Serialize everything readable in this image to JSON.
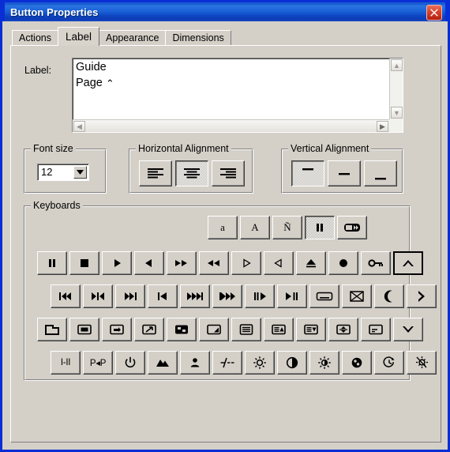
{
  "window": {
    "title": "Button Properties",
    "close_label": "Close"
  },
  "tabs": [
    {
      "label": "Actions",
      "selected": false
    },
    {
      "label": "Label",
      "selected": true
    },
    {
      "label": "Appearance",
      "selected": false
    },
    {
      "label": "Dimensions",
      "selected": false
    }
  ],
  "label_section": {
    "caption": "Label:",
    "value_line1": "Guide",
    "value_line2": "Page",
    "value_glyph": "⌃",
    "scroll_up": "▲",
    "scroll_down": "▼",
    "scroll_left": "◀",
    "scroll_right": "▶"
  },
  "font_size": {
    "group_title": "Font size",
    "value": "12",
    "dropdown_icon": "▼"
  },
  "horizontal_alignment": {
    "group_title": "Horizontal Alignment",
    "buttons": [
      {
        "name": "align-left",
        "selected": false
      },
      {
        "name": "align-center",
        "selected": true
      },
      {
        "name": "align-right",
        "selected": false
      }
    ]
  },
  "vertical_alignment": {
    "group_title": "Vertical Alignment",
    "buttons": [
      {
        "name": "align-top",
        "selected": true
      },
      {
        "name": "align-middle",
        "selected": false
      },
      {
        "name": "align-bottom",
        "selected": false
      }
    ]
  },
  "keyboards": {
    "group_title": "Keyboards",
    "rows": [
      {
        "id": "row1",
        "buttons": [
          {
            "icon": "lowercase-a-icon",
            "text": "a",
            "state": "normal"
          },
          {
            "icon": "uppercase-a-icon",
            "text": "A",
            "state": "normal"
          },
          {
            "icon": "n-tilde-icon",
            "text": "Ñ",
            "state": "normal"
          },
          {
            "icon": "pause-icon",
            "text": "",
            "state": "pressed"
          },
          {
            "icon": "remote-device-icon",
            "text": "",
            "state": "normal"
          }
        ]
      },
      {
        "id": "row2",
        "buttons": [
          {
            "icon": "pause-icon",
            "text": "",
            "state": "normal"
          },
          {
            "icon": "stop-icon",
            "text": "",
            "state": "normal"
          },
          {
            "icon": "play-icon",
            "text": "",
            "state": "normal"
          },
          {
            "icon": "play-reverse-icon",
            "text": "",
            "state": "normal"
          },
          {
            "icon": "fast-forward-icon",
            "text": "",
            "state": "normal"
          },
          {
            "icon": "rewind-icon",
            "text": "",
            "state": "normal"
          },
          {
            "icon": "play-outline-icon",
            "text": "",
            "state": "normal"
          },
          {
            "icon": "play-reverse-outline-icon",
            "text": "",
            "state": "normal"
          },
          {
            "icon": "eject-icon",
            "text": "",
            "state": "normal"
          },
          {
            "icon": "record-icon",
            "text": "",
            "state": "normal"
          },
          {
            "icon": "key-icon",
            "text": "",
            "state": "normal"
          },
          {
            "icon": "chevron-up-icon",
            "text": "",
            "state": "focused"
          }
        ]
      },
      {
        "id": "row3",
        "buttons": [
          {
            "icon": "skip-previous-bar-icon",
            "text": "",
            "state": "normal"
          },
          {
            "icon": "step-both-icon",
            "text": "",
            "state": "normal"
          },
          {
            "icon": "skip-next-bar-icon",
            "text": "",
            "state": "normal"
          },
          {
            "icon": "previous-track-icon",
            "text": "",
            "state": "normal"
          },
          {
            "icon": "next-track-double-icon",
            "text": "",
            "state": "normal"
          },
          {
            "icon": "previous-track-double-icon",
            "text": "",
            "state": "normal"
          },
          {
            "icon": "pause-play-icon",
            "text": "",
            "state": "normal"
          },
          {
            "icon": "play-pause-reverse-icon",
            "text": "",
            "state": "normal"
          },
          {
            "icon": "subtitle-icon",
            "text": "",
            "state": "normal"
          },
          {
            "icon": "crossed-box-icon",
            "text": "",
            "state": "normal"
          },
          {
            "icon": "moon-icon",
            "text": "",
            "state": "normal"
          },
          {
            "icon": "chevron-right-icon",
            "text": "",
            "state": "normal"
          }
        ]
      },
      {
        "id": "row4",
        "buttons": [
          {
            "icon": "screen-corner-icon",
            "text": "",
            "state": "normal"
          },
          {
            "icon": "screen-filled-icon",
            "text": "",
            "state": "normal"
          },
          {
            "icon": "screen-swap-icon",
            "text": "",
            "state": "normal"
          },
          {
            "icon": "screen-expand-icon",
            "text": "",
            "state": "normal"
          },
          {
            "icon": "screen-split-icon",
            "text": "",
            "state": "normal"
          },
          {
            "icon": "screen-corner-fill-icon",
            "text": "",
            "state": "normal"
          },
          {
            "icon": "menu-lines-icon",
            "text": "",
            "state": "normal"
          },
          {
            "icon": "screen-up-marker-icon",
            "text": "",
            "state": "normal"
          },
          {
            "icon": "screen-down-marker-icon",
            "text": "",
            "state": "normal"
          },
          {
            "icon": "screen-updown-icon",
            "text": "",
            "state": "normal"
          },
          {
            "icon": "screen-dash-icon",
            "text": "",
            "state": "normal"
          },
          {
            "icon": "chevron-down-icon",
            "text": "",
            "state": "normal"
          }
        ]
      },
      {
        "id": "row5",
        "buttons": [
          {
            "icon": "audio-mode-icon",
            "text": "I-II",
            "state": "normal"
          },
          {
            "icon": "pip-icon",
            "text": "P◂P",
            "state": "normal"
          },
          {
            "icon": "power-icon",
            "text": "",
            "state": "normal"
          },
          {
            "icon": "mountains-icon",
            "text": "",
            "state": "normal"
          },
          {
            "icon": "person-icon",
            "text": "",
            "state": "normal"
          },
          {
            "icon": "slash-dash-icon",
            "text": "",
            "state": "normal"
          },
          {
            "icon": "brightness-icon",
            "text": "",
            "state": "normal"
          },
          {
            "icon": "contrast-icon",
            "text": "",
            "state": "normal"
          },
          {
            "icon": "brightness-half-icon",
            "text": "",
            "state": "normal"
          },
          {
            "icon": "color-icon",
            "text": "",
            "state": "normal"
          },
          {
            "icon": "timer-icon",
            "text": "",
            "state": "normal"
          },
          {
            "icon": "backlight-icon",
            "text": "",
            "state": "normal"
          }
        ]
      }
    ]
  },
  "colors": {
    "title_bar_blue": "#0d45c0",
    "window_face": "#d4d0c8",
    "close_red": "#d8412b"
  }
}
